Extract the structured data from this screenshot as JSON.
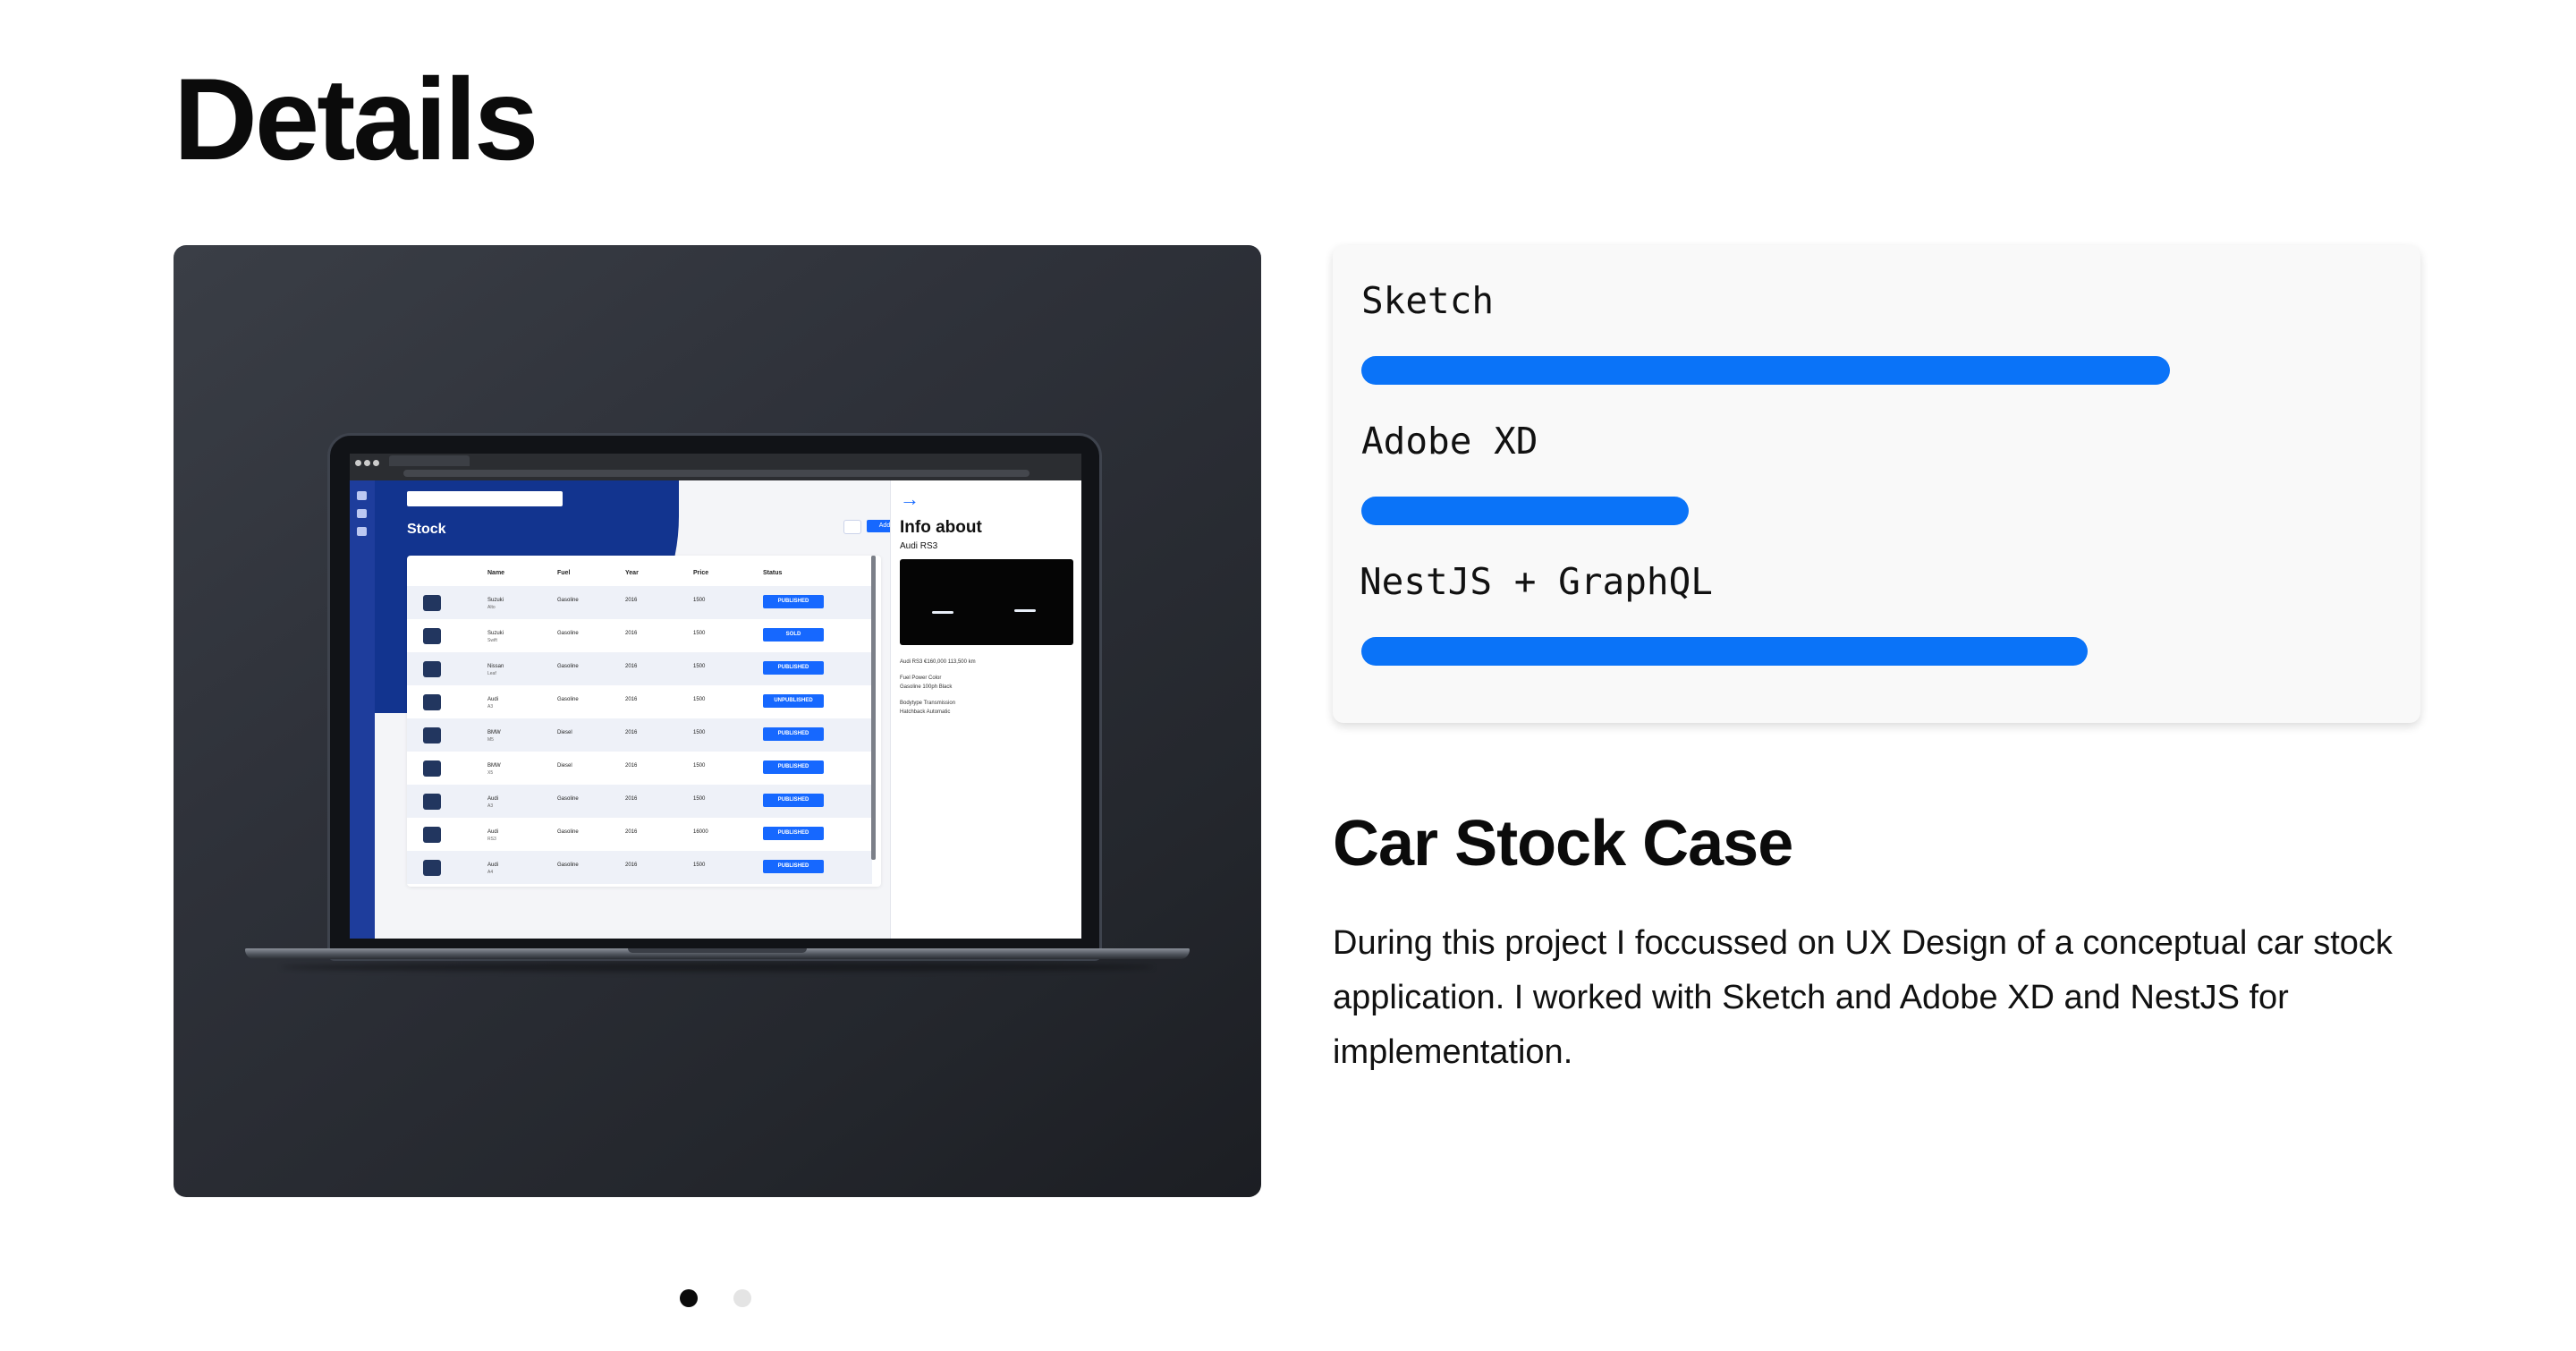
{
  "page": {
    "title": "Details"
  },
  "project": {
    "title": "Car Stock Case",
    "description": "During this project I foccussed on UX Design of a conceptual car stock application. I worked with Sketch and Adobe XD and NestJS for implementation."
  },
  "skills": [
    {
      "name": "Sketch",
      "level": 0.79
    },
    {
      "name": "Adobe XD",
      "level": 0.32
    },
    {
      "name": "NestJS + GraphQL",
      "level": 0.71
    }
  ],
  "carousel": {
    "slides": 2,
    "active": 0
  },
  "mockup": {
    "app_title": "Stock",
    "add_label": "Add",
    "columns": [
      "Name",
      "Fuel",
      "Year",
      "Price",
      "Status"
    ],
    "rows": [
      {
        "make": "Suzuki",
        "model": "Alto",
        "fuel": "Gasoline",
        "year": "2016",
        "price": "1500",
        "status": "PUBLISHED"
      },
      {
        "make": "Suzuki",
        "model": "Swift",
        "fuel": "Gasoline",
        "year": "2016",
        "price": "1500",
        "status": "SOLD"
      },
      {
        "make": "Nissan",
        "model": "Leaf",
        "fuel": "Gasoline",
        "year": "2016",
        "price": "1500",
        "status": "PUBLISHED"
      },
      {
        "make": "Audi",
        "model": "A3",
        "fuel": "Gasoline",
        "year": "2016",
        "price": "1500",
        "status": "UNPUBLISHED"
      },
      {
        "make": "BMW",
        "model": "M5",
        "fuel": "Diesel",
        "year": "2016",
        "price": "1500",
        "status": "PUBLISHED"
      },
      {
        "make": "BMW",
        "model": "X5",
        "fuel": "Diesel",
        "year": "2016",
        "price": "1500",
        "status": "PUBLISHED"
      },
      {
        "make": "Audi",
        "model": "A3",
        "fuel": "Gasoline",
        "year": "2016",
        "price": "1500",
        "status": "PUBLISHED"
      },
      {
        "make": "Audi",
        "model": "RS3",
        "fuel": "Gasoline",
        "year": "2016",
        "price": "16000",
        "status": "PUBLISHED"
      },
      {
        "make": "Audi",
        "model": "A4",
        "fuel": "Gasoline",
        "year": "2016",
        "price": "1500",
        "status": "PUBLISHED"
      }
    ],
    "panel": {
      "arrow": "→",
      "title": "Info about",
      "subtitle": "Audi RS3",
      "meta": [
        "Audi RS3        €160,000        113,500 km",
        "Fuel              Power              Color",
        "Gasoline        100ph              Black",
        "Bodytype        Transmission",
        "Hatchback      Automatic"
      ]
    }
  },
  "colors": {
    "accent": "#0a73f8",
    "card_dark": "#2b2e35"
  }
}
